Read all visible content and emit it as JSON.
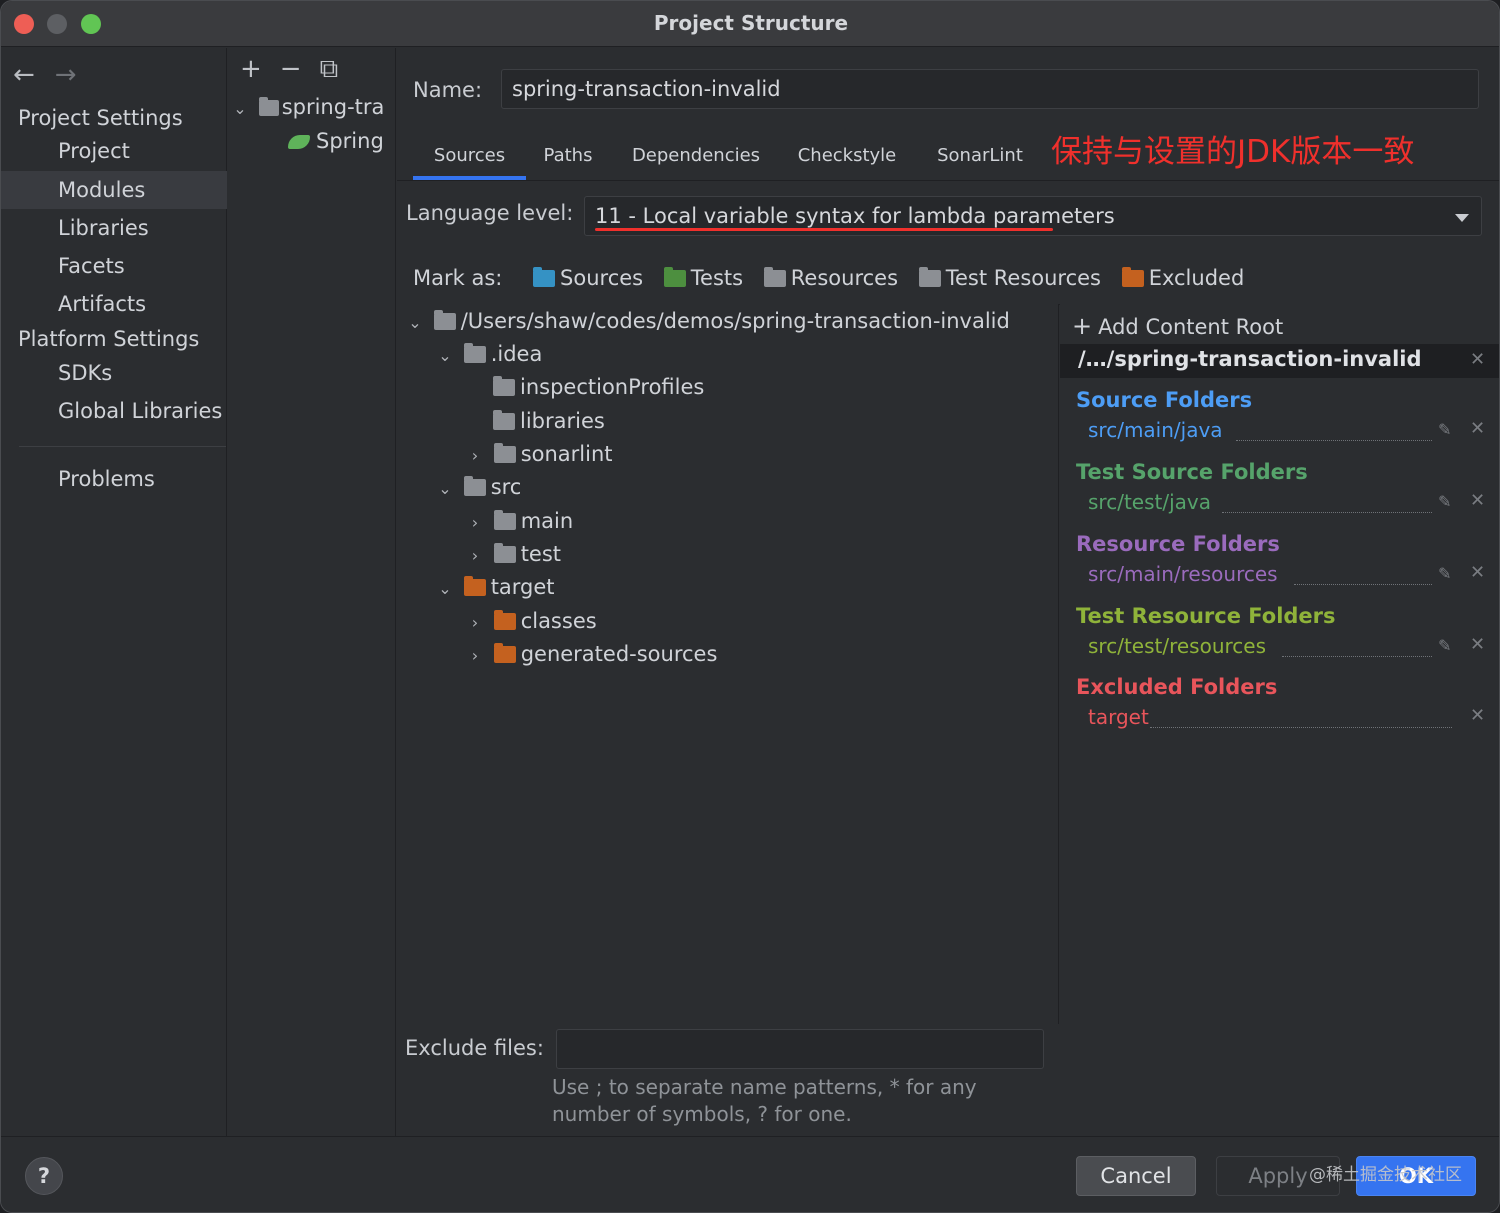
{
  "window": {
    "title": "Project Structure"
  },
  "nav": {
    "back_icon": "←",
    "forward_icon": "→"
  },
  "sidebar": {
    "project_settings": "Project Settings",
    "project_items": [
      "Project",
      "Modules",
      "Libraries",
      "Facets",
      "Artifacts"
    ],
    "platform_settings": "Platform Settings",
    "platform_items": [
      "SDKs",
      "Global Libraries"
    ],
    "problems": "Problems",
    "selected": "Modules"
  },
  "modules": {
    "toolbar": {
      "add": "+",
      "remove": "−",
      "copy": "⧉"
    },
    "module_name": "spring-tra",
    "facet_name": "Spring"
  },
  "main": {
    "name_label": "Name:",
    "name_value": "spring-transaction-invalid",
    "tabs": [
      "Sources",
      "Paths",
      "Dependencies",
      "Checkstyle",
      "SonarLint"
    ],
    "selected_tab": "Sources",
    "annotation": "保持与设置的JDK版本一致",
    "annotation_color": "#f0302c",
    "language_level_label": "Language level:",
    "language_level_value": "11 - Local variable syntax for lambda parameters",
    "mark_as_label": "Mark as:",
    "mark_as": [
      "Sources",
      "Tests",
      "Resources",
      "Test Resources",
      "Excluded"
    ],
    "tree": {
      "root": "/Users/shaw/codes/demos/spring-transaction-invalid",
      "idea": ".idea",
      "inspection_profiles": "inspectionProfiles",
      "libraries": "libraries",
      "sonarlint": "sonarlint",
      "src": "src",
      "main": "main",
      "test": "test",
      "target": "target",
      "classes": "classes",
      "generated_sources": "generated-sources"
    },
    "exclude_files_label": "Exclude files:",
    "exclude_files_value": "",
    "exclude_hint_line1": "Use ; to separate name patterns, * for any",
    "exclude_hint_line2": "number of symbols, ? for one."
  },
  "content_root": {
    "add_label": "Add Content Root",
    "root_name": "/…/spring-transaction-invalid",
    "groups": {
      "source": {
        "title": "Source Folders",
        "path": "src/main/java",
        "color": "#4d9df5"
      },
      "test_source": {
        "title": "Test Source Folders",
        "path": "src/test/java",
        "color": "#56a36b"
      },
      "resource": {
        "title": "Resource Folders",
        "path": "src/main/resources",
        "color": "#9a6bbd"
      },
      "test_resource": {
        "title": "Test Resource Folders",
        "path": "src/test/resources",
        "color": "#8fb33a"
      },
      "excluded": {
        "title": "Excluded Folders",
        "path": "target",
        "color": "#e8555b"
      }
    }
  },
  "footer": {
    "help": "?",
    "cancel": "Cancel",
    "apply": "Apply",
    "ok": "OK",
    "watermark": "@稀土掘金技术社区"
  }
}
